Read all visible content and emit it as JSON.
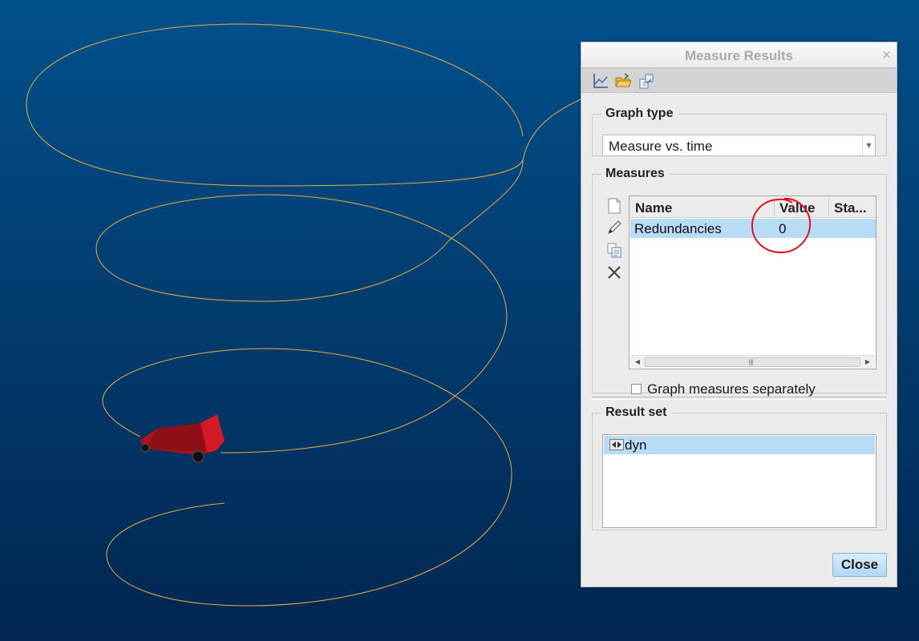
{
  "dialog": {
    "title": "Measure Results",
    "close_glyph": "×",
    "toolbar": {
      "icons": [
        "graph-icon",
        "open-folder-icon",
        "export-icon"
      ]
    },
    "graph_type": {
      "legend": "Graph type",
      "selected": "Measure vs. time"
    },
    "measures": {
      "legend": "Measures",
      "tool_icons": [
        "new-measure-icon",
        "edit-pencil-icon",
        "copy-icon",
        "delete-x-icon"
      ],
      "columns": [
        "Name",
        "Value",
        "Sta..."
      ],
      "rows": [
        {
          "name": "Redundancies",
          "value": "0",
          "status": ""
        }
      ],
      "graph_separately_label": "Graph measures separately",
      "graph_separately_checked": false
    },
    "result_set": {
      "legend": "Result set",
      "items": [
        {
          "label": "dyn",
          "icon": "result-set-icon"
        }
      ]
    },
    "close_button": "Close"
  },
  "colors": {
    "background_top": "#02508c",
    "background_bottom": "#012651",
    "trajectory": "#e3b040",
    "vehicle": "#b0131b",
    "selection": "#b8dcf6",
    "annotation_circle": "#e01010"
  }
}
